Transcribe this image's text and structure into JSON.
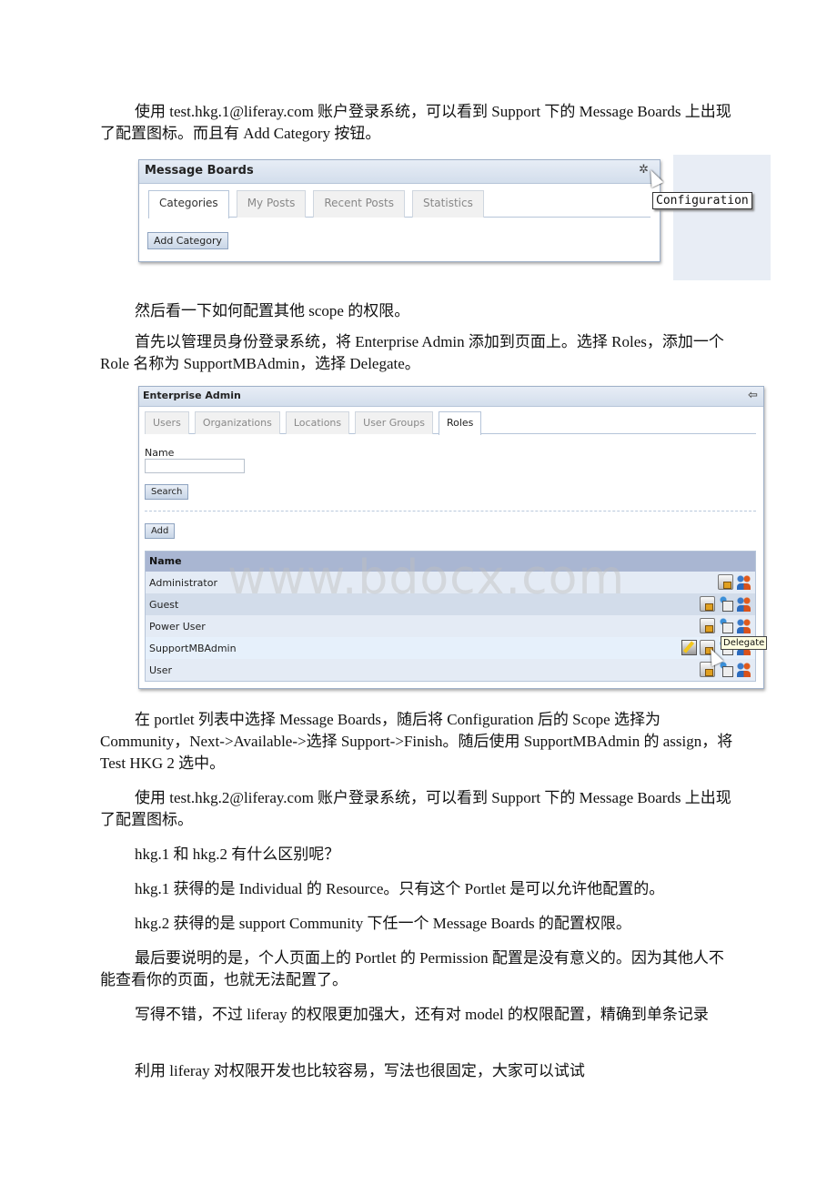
{
  "paragraphs": {
    "p1": "使用 test.hkg.1@liferay.com 账户登录系统，可以看到 Support 下的 Message Boards 上出现了配置图标。而且有 Add Category 按钮。",
    "p2": "然后看一下如何配置其他 scope 的权限。",
    "p3": "首先以管理员身份登录系统，将 Enterprise Admin 添加到页面上。选择 Roles，添加一个 Role 名称为 SupportMBAdmin，选择 Delegate。",
    "p4": "在 portlet 列表中选择 Message Boards，随后将 Configuration 后的 Scope 选择为 Community，Next->Available->选择 Support->Finish。随后使用 SupportMBAdmin 的 assign，将 Test HKG 2 选中。",
    "p5": "使用 test.hkg.2@liferay.com 账户登录系统，可以看到 Support 下的 Message Boards 上出现了配置图标。",
    "p6": "hkg.1 和 hkg.2 有什么区别呢？",
    "p7": "hkg.1 获得的是 Individual 的 Resource。只有这个 Portlet 是可以允许他配置的。",
    "p8": "hkg.2 获得的是 support Community 下任一个 Message Boards 的配置权限。",
    "p9": "最后要说明的是，个人页面上的 Portlet 的 Permission 配置是没有意义的。因为其他人不能查看你的页面，也就无法配置了。",
    "p10": "写得不错，不过 liferay 的权限更加强大，还有对 model 的权限配置，精确到单条记录",
    "p11": "利用 liferay 对权限开发也比较容易，写法也很固定，大家可以试试"
  },
  "message_boards": {
    "title": "Message Boards",
    "config_icon": "gear-icon",
    "tooltip": "Configuration",
    "tabs": [
      {
        "label": "Categories",
        "active": true
      },
      {
        "label": "My Posts",
        "active": false
      },
      {
        "label": "Recent Posts",
        "active": false
      },
      {
        "label": "Statistics",
        "active": false
      }
    ],
    "add_category_label": "Add Category"
  },
  "enterprise_admin": {
    "title": "Enterprise Admin",
    "back_icon": "back-arrow-icon",
    "tabs": [
      {
        "label": "Users",
        "active": false
      },
      {
        "label": "Organizations",
        "active": false
      },
      {
        "label": "Locations",
        "active": false
      },
      {
        "label": "User Groups",
        "active": false
      },
      {
        "label": "Roles",
        "active": true
      }
    ],
    "name_label": "Name",
    "name_value": "",
    "search_label": "Search",
    "add_label": "Add",
    "table_header": "Name",
    "rows": [
      {
        "name": "Administrator",
        "icons": [
          "permissions-icon",
          "assign-members-icon"
        ]
      },
      {
        "name": "Guest",
        "icons": [
          "permissions-icon",
          "delegate-icon",
          "assign-members-icon"
        ]
      },
      {
        "name": "Power User",
        "icons": [
          "permissions-icon",
          "delegate-icon",
          "assign-members-icon"
        ]
      },
      {
        "name": "SupportMBAdmin",
        "icons": [
          "edit-icon",
          "permissions-icon",
          "delegate-icon",
          "assign-members-icon"
        ]
      },
      {
        "name": "User",
        "icons": [
          "permissions-icon",
          "delegate-icon",
          "assign-members-icon"
        ]
      }
    ],
    "tooltip": "Delegate"
  },
  "watermark": "www.bdocx.com"
}
